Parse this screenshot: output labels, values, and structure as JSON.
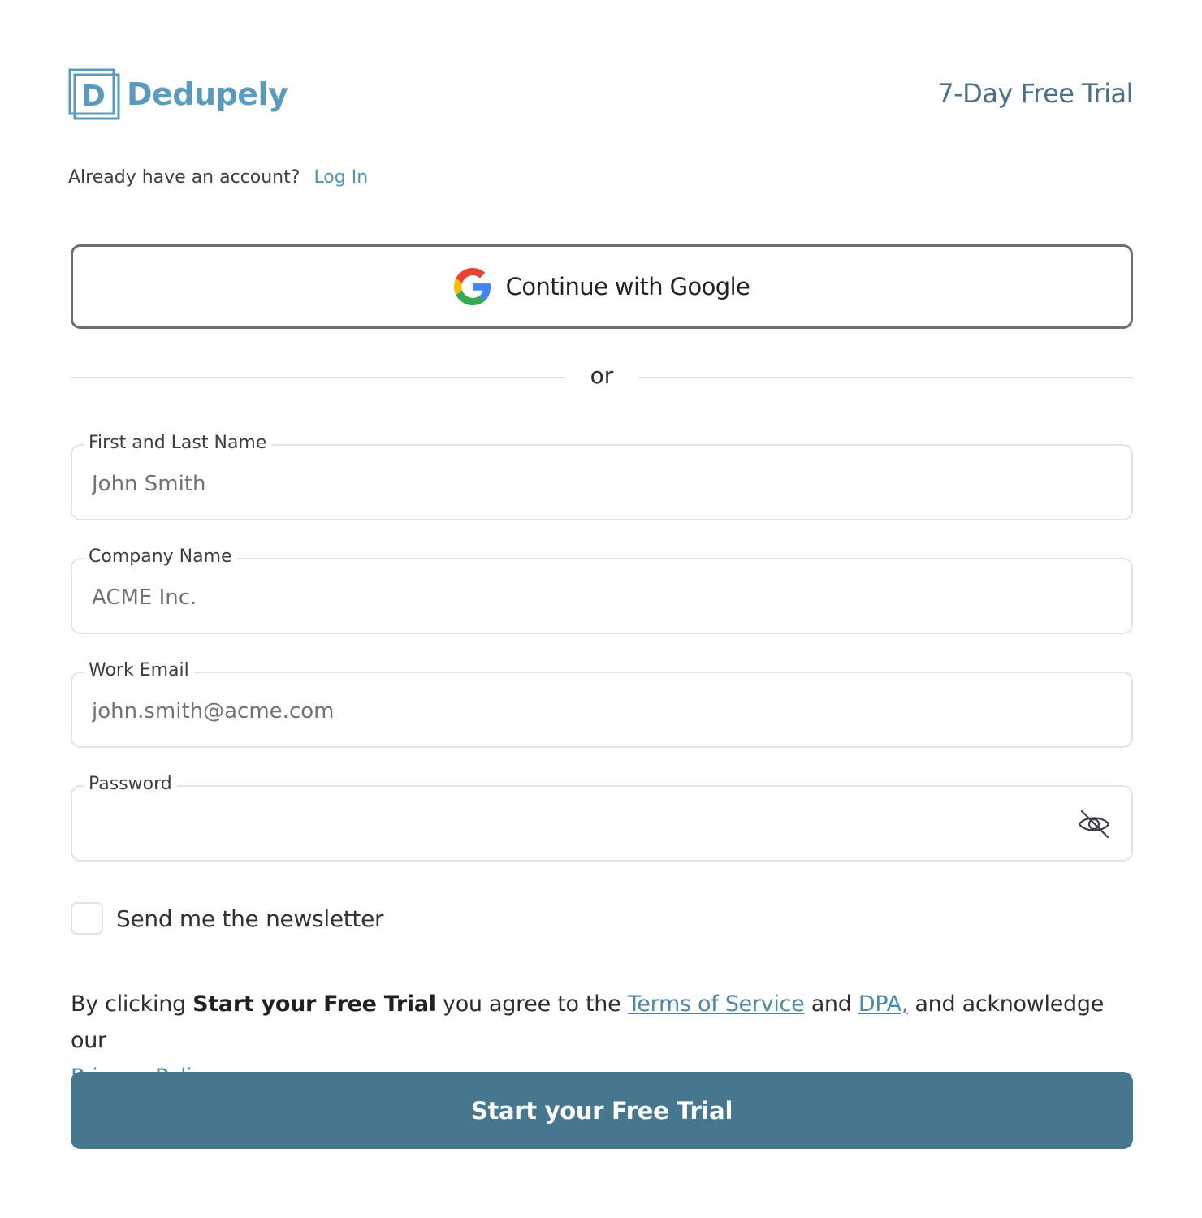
{
  "brand": {
    "name": "Dedupely",
    "logo_letter": "D",
    "color": "#5a9bbd"
  },
  "header": {
    "trial_label": "7-Day Free Trial"
  },
  "login": {
    "prompt": "Already have an account?",
    "link_label": "Log In"
  },
  "google_button": {
    "label": "Continue with Google",
    "icon": "google-icon"
  },
  "divider": {
    "label": "or"
  },
  "form": {
    "name": {
      "label": "First and Last Name",
      "placeholder": "John Smith",
      "value": ""
    },
    "company": {
      "label": "Company Name",
      "placeholder": "ACME Inc.",
      "value": ""
    },
    "email": {
      "label": "Work Email",
      "placeholder": "john.smith@acme.com",
      "value": ""
    },
    "password": {
      "label": "Password",
      "placeholder": "",
      "value": "",
      "toggle_icon": "eye-off-icon"
    }
  },
  "newsletter": {
    "label": "Send me the newsletter",
    "checked": false
  },
  "legal": {
    "prefix": "By clicking",
    "cta_ref": "Start your Free Trial",
    "middle": "you agree to the",
    "terms_label": "Terms of Service",
    "and": "and",
    "dpa_label": "DPA,",
    "suffix": "and acknowledge our",
    "privacy_label": "Privacy Policy."
  },
  "submit": {
    "label": "Start your Free Trial",
    "color": "#46778f"
  }
}
